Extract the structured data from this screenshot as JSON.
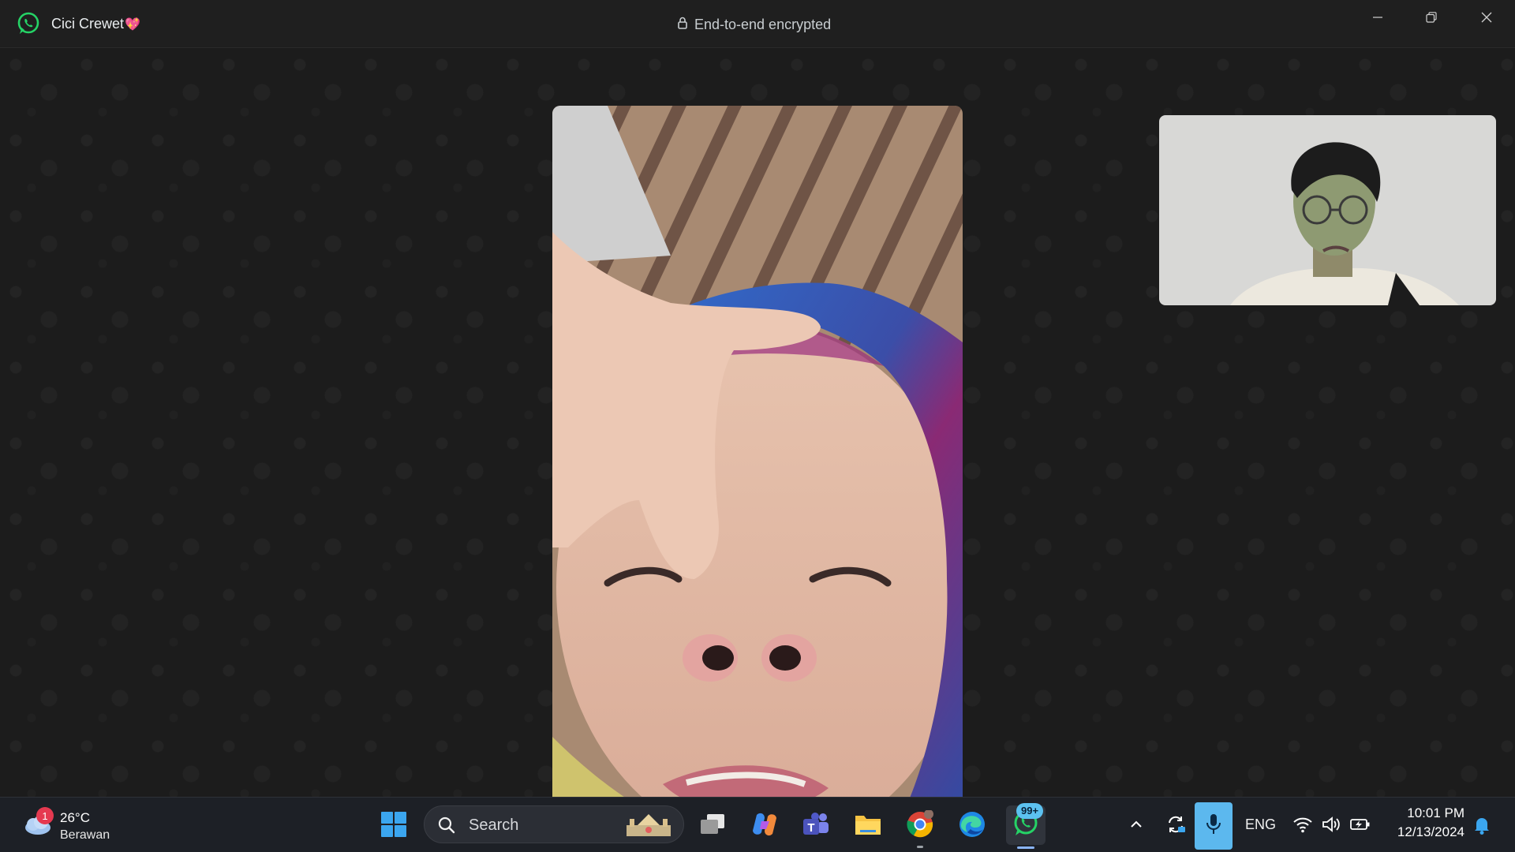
{
  "titlebar": {
    "contact_name": "Cici Crewet",
    "contact_emoji": "💖",
    "encryption_label": "End-to-end encrypted",
    "minimize_icon": "minimize-icon",
    "restore_icon": "restore-icon",
    "close_icon": "close-icon"
  },
  "call": {
    "remote_video": "remote-participant-video",
    "self_video": "self-preview-video"
  },
  "taskbar": {
    "weather": {
      "temperature": "26°C",
      "condition": "Berawan",
      "badge_count": "1"
    },
    "search": {
      "label": "Search"
    },
    "pinned_apps": [
      "start-button",
      "task-view",
      "copilot",
      "teams",
      "file-explorer",
      "chrome",
      "edge",
      "whatsapp"
    ],
    "whatsapp_badge": "99+",
    "tray": {
      "language": "ENG",
      "time": "10:01 PM",
      "date": "12/13/2024"
    }
  },
  "colors": {
    "whatsapp_green": "#25d366",
    "mic_active": "#5cb8ee",
    "badge_red": "#e53950"
  }
}
